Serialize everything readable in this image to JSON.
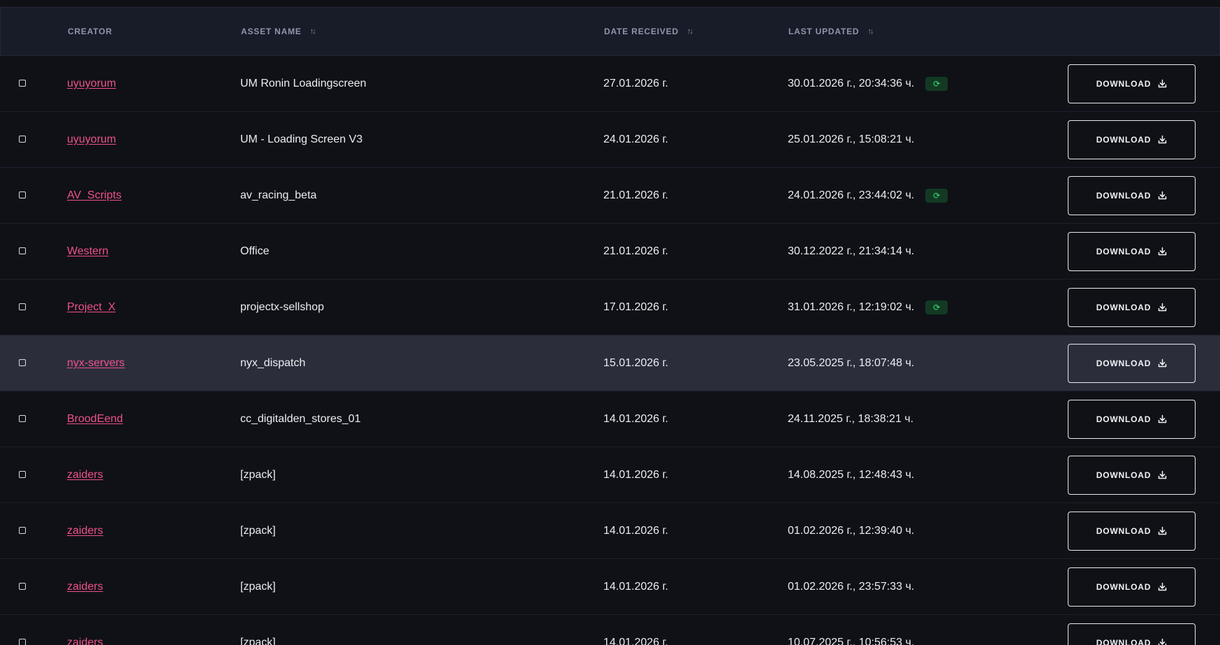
{
  "header": {
    "creator": "CREATOR",
    "asset_name": "ASSET NAME",
    "date_received": "DATE RECEIVED",
    "last_updated": "LAST UPDATED"
  },
  "download_label": "DOWNLOAD",
  "rows": [
    {
      "creator": "uyuyorum",
      "asset": "UM Ronin Loadingscreen",
      "received": "27.01.2026 г.",
      "updated": "30.01.2026 г., 20:34:36 ч.",
      "sync": true,
      "highlight": false
    },
    {
      "creator": "uyuyorum",
      "asset": "UM - Loading Screen V3",
      "received": "24.01.2026 г.",
      "updated": "25.01.2026 г., 15:08:21 ч.",
      "sync": false,
      "highlight": false
    },
    {
      "creator": "AV_Scripts",
      "asset": "av_racing_beta",
      "received": "21.01.2026 г.",
      "updated": "24.01.2026 г., 23:44:02 ч.",
      "sync": true,
      "highlight": false
    },
    {
      "creator": "Western",
      "asset": "Office",
      "received": "21.01.2026 г.",
      "updated": "30.12.2022 г., 21:34:14 ч.",
      "sync": false,
      "highlight": false
    },
    {
      "creator": "Project_X",
      "asset": "projectx-sellshop",
      "received": "17.01.2026 г.",
      "updated": "31.01.2026 г., 12:19:02 ч.",
      "sync": true,
      "highlight": false
    },
    {
      "creator": "nyx-servers",
      "asset": "nyx_dispatch",
      "received": "15.01.2026 г.",
      "updated": "23.05.2025 г., 18:07:48 ч.",
      "sync": false,
      "highlight": true
    },
    {
      "creator": "BroodEend",
      "asset": "cc_digitalden_stores_01",
      "received": "14.01.2026 г.",
      "updated": "24.11.2025 г., 18:38:21 ч.",
      "sync": false,
      "highlight": false
    },
    {
      "creator": "zaiders",
      "asset": "[zpack]",
      "received": "14.01.2026 г.",
      "updated": "14.08.2025 г., 12:48:43 ч.",
      "sync": false,
      "highlight": false
    },
    {
      "creator": "zaiders",
      "asset": "[zpack]",
      "received": "14.01.2026 г.",
      "updated": "01.02.2026 г., 12:39:40 ч.",
      "sync": false,
      "highlight": false
    },
    {
      "creator": "zaiders",
      "asset": "[zpack]",
      "received": "14.01.2026 г.",
      "updated": "01.02.2026 г., 23:57:33 ч.",
      "sync": false,
      "highlight": false
    },
    {
      "creator": "zaiders",
      "asset": "[zpack]",
      "received": "14.01.2026 г.",
      "updated": "10.07.2025 г., 10:56:53 ч.",
      "sync": false,
      "highlight": false
    }
  ]
}
